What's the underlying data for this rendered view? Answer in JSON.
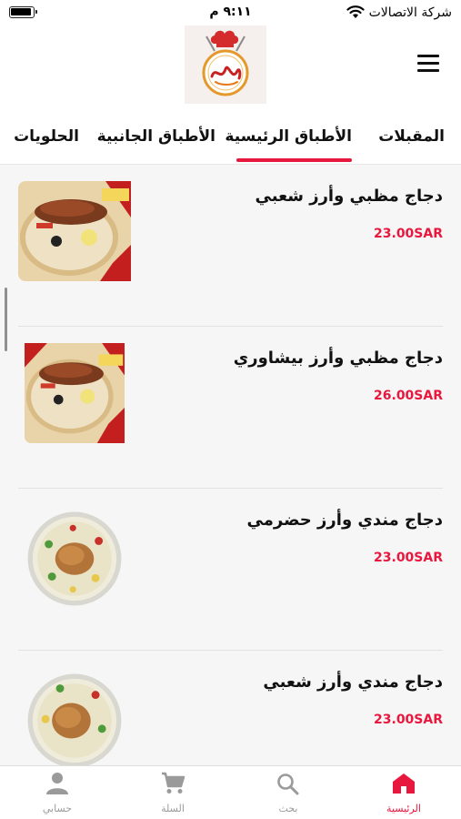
{
  "status_bar": {
    "carrier": "شركة الاتصالات",
    "time": "٩:١١ م"
  },
  "header": {
    "logo_icon": "restaurant-logo-chef-hat",
    "menu_icon": "hamburger-menu-icon"
  },
  "tabs": [
    {
      "label": "المقبلات",
      "active": false
    },
    {
      "label": "الأطباق الرئيسية",
      "active": true
    },
    {
      "label": "الأطباق الجانبية",
      "active": false
    },
    {
      "label": "الحلويات",
      "active": false
    }
  ],
  "menu_items": [
    {
      "name": "دجاج مظبي وأرز شعبي",
      "price": "23.00SAR",
      "image": "grilled-chicken-rice-square"
    },
    {
      "name": "دجاج مظبي وأرز بيشاوري",
      "price": "26.00SAR",
      "image": "grilled-chicken-rice-square"
    },
    {
      "name": "دجاج مندي وأرز حضرمي",
      "price": "23.00SAR",
      "image": "mandi-chicken-round-plate"
    },
    {
      "name": "دجاج مندي وأرز شعبي",
      "price": "23.00SAR",
      "image": "mandi-chicken-round-plate"
    }
  ],
  "bottom_nav": [
    {
      "label": "الرئيسية",
      "icon": "home-icon",
      "active": true
    },
    {
      "label": "بحث",
      "icon": "search-icon",
      "active": false
    },
    {
      "label": "السلة",
      "icon": "cart-icon",
      "active": false
    },
    {
      "label": "حسابي",
      "icon": "person-icon",
      "active": false
    }
  ],
  "colors": {
    "accent": "#e8173d",
    "list_background": "#f6f6f6",
    "inactive_nav": "#9a9a9a"
  }
}
